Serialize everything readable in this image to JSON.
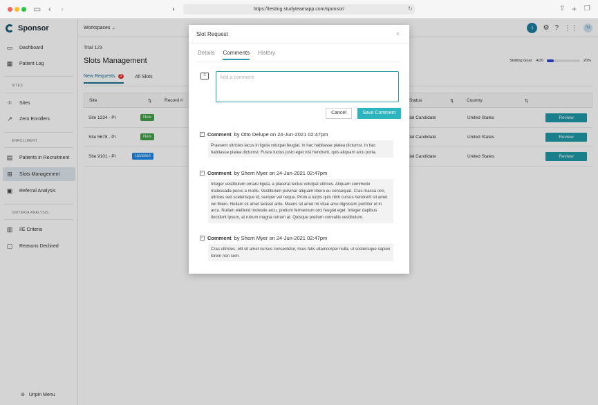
{
  "browser": {
    "url": "https://testing.studyteamapp.com/sponsor/"
  },
  "sidebar": {
    "brand": "Sponsor",
    "items": [
      {
        "label": "Dashboard",
        "icon": "dashboard-icon"
      },
      {
        "label": "Patient Log",
        "icon": "table-icon"
      },
      {
        "label": "Sites",
        "icon": "location-icon"
      },
      {
        "label": "Zero Enrollers",
        "icon": "trend-icon"
      },
      {
        "label": "Patients in Recruitment",
        "icon": "card-icon"
      },
      {
        "label": "Slots Management",
        "icon": "grid-icon"
      },
      {
        "label": "Referral Analysis",
        "icon": "report-icon"
      },
      {
        "label": "I/E Criteria",
        "icon": "bar-chart-icon"
      },
      {
        "label": "Reasons Declined",
        "icon": "comment-icon"
      }
    ],
    "sections": [
      "SITES",
      "ENROLLMENT",
      "CRITERIA ANALYSIS"
    ],
    "unpin_label": "Unpin Menu"
  },
  "topbar": {
    "workspaces_label": "Workspaces",
    "avatar_initials": "SI"
  },
  "main": {
    "breadcrumb": "Trial 123",
    "title": "Slots Management",
    "slotting_goal_label": "Slotting Goal:",
    "slotting_goal_value": "4/20",
    "slotting_goal_percent": "20%",
    "slotting_goal_fraction": 0.2,
    "tabs": [
      {
        "label": "New Requests",
        "count": "3"
      },
      {
        "label": "All Slots"
      }
    ],
    "table": {
      "headers": [
        "Site",
        "Record #",
        "Status",
        "Country"
      ],
      "rows": [
        {
          "site": "Site 1234 - PI",
          "badge": "New",
          "status": "tial Candidate",
          "country": "United States",
          "action": "Review"
        },
        {
          "site": "Site 5678 - PI",
          "badge": "New",
          "status": "tial Candidate",
          "country": "United States",
          "action": "Review"
        },
        {
          "site": "Site 9101 - PI",
          "badge": "Updated",
          "status": "tial Candidate",
          "country": "United States",
          "action": "Review"
        }
      ]
    }
  },
  "modal": {
    "title": "Slot Request",
    "close": "×",
    "tabs": [
      "Details",
      "Comments",
      "History"
    ],
    "comment_placeholder": "Add a comment",
    "cancel_label": "Cancel",
    "save_label": "Save Comment",
    "comments": [
      {
        "label": "Comment",
        "by": "by Otto Delupe on 24-Jun-2021 02:47pm",
        "text": "Praesent ultricies lacus in ligula volutpat feugiat. In hac habitasse platea dictumst. In hac habitasse platea dictumst. Fusce luctus justo eget nisi hendrerit, quis aliquam arcu porta."
      },
      {
        "label": "Comment",
        "by": "by Sherri Myer on 24-Jun-2021 02:47pm",
        "text": "Integer vestibulum ornare ligula, a placerat lectus volutpat ultrices. Aliquam commodo malesuada purus a mollis. Vestibulum pulvinar aliquam libero eu consequat. Cras massa orci, ultrices sed scelerisque id, semper vel neque. Proin a turpis quis nibh cursus hendrerit sit amet vel libero. Nullam sit amet laoreet ante. Mauris sit amet mi vitae arcu dignissim porttitor et in arcu. Nullam eleifend molestie arcu, pretium fermentum orci feugiat eget. Integer dapibus tincidunt ipsum, at rutrum magna rutrum at. Quisque pretium convallis vestibulum."
      },
      {
        "label": "Comment",
        "by": "by Sherri Myer on 24-Jun-2021 02:47pm",
        "text": "Cras ultricies, elit sit amet cursus consectetur, risus felis ullamcorper nulla, ut scelerisque sapien lorem non sem."
      }
    ]
  },
  "colors": {
    "accent": "#2bb5bf",
    "primary": "#1c6f91",
    "new_badge": "#43a047",
    "updated_badge": "#1e88e5"
  }
}
